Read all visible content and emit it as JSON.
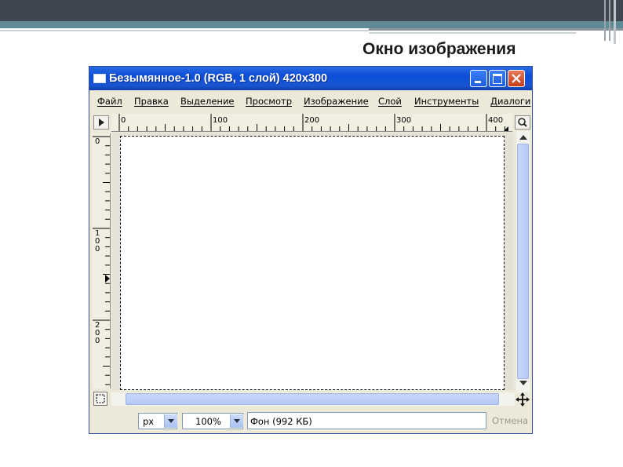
{
  "slide": {
    "title": "Окно изображения"
  },
  "window": {
    "title": "Безымянное-1.0 (RGB, 1 слой) 420x300",
    "menu": [
      "Файл",
      "Правка",
      "Выделение",
      "Просмотр",
      "Изображение",
      "Слой",
      "Инструменты",
      "Диалоги"
    ]
  },
  "rulers": {
    "horizontal_labels": [
      "0",
      "100",
      "200",
      "300",
      "400"
    ],
    "vertical_labels": [
      "0",
      "1\n0\n0",
      "2\n0\n0"
    ]
  },
  "status_bar": {
    "unit": "px",
    "zoom": "100%",
    "info": "Фон (992 КБ)",
    "cancel_label": "Отмена"
  },
  "icons": {
    "navigate": "play-triangle-icon",
    "zoom": "magnifier-icon",
    "quick_mask": "dashed-square-icon",
    "move": "four-arrows-icon"
  },
  "colors": {
    "titlebar": "#0a4ed8",
    "window_bg": "#ece9d8",
    "scrollbar_thumb": "#b6c9f5",
    "slide_band": "#3f4650"
  }
}
